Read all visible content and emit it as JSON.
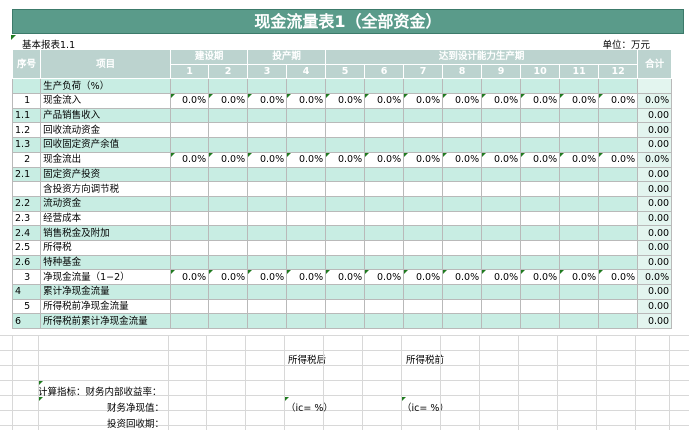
{
  "title": "现金流量表1（全部资金）",
  "subtitle_left": "基本报表1.1",
  "subtitle_right": "单位：万元",
  "headers": {
    "seq": "序号",
    "item": "项目",
    "construction": "建设期",
    "production": "投产期",
    "design_capacity": "达到设计能力生产期",
    "total": "合计",
    "periods": [
      "1",
      "2",
      "3",
      "4",
      "5",
      "6",
      "7",
      "8",
      "9",
      "10",
      "11",
      "12"
    ]
  },
  "rows": [
    {
      "seq": "",
      "label": "生产负荷（%）",
      "hl": true,
      "vals": [
        "",
        "",
        "",
        "",
        "",
        "",
        "",
        "",
        "",
        "",
        "",
        ""
      ],
      "total": ""
    },
    {
      "seq": "1",
      "label": "现金流入",
      "hl": false,
      "vals": [
        "0.0%",
        "0.0%",
        "0.0%",
        "0.0%",
        "0.0%",
        "0.0%",
        "0.0%",
        "0.0%",
        "0.0%",
        "0.0%",
        "0.0%",
        "0.0%"
      ],
      "total": "0.0%"
    },
    {
      "seq": "1.1",
      "label": "产品销售收入",
      "hl": true,
      "vals": [
        "",
        "",
        "",
        "",
        "",
        "",
        "",
        "",
        "",
        "",
        "",
        ""
      ],
      "total": "0.00"
    },
    {
      "seq": "1.2",
      "label": "回收流动资金",
      "hl": false,
      "vals": [
        "",
        "",
        "",
        "",
        "",
        "",
        "",
        "",
        "",
        "",
        "",
        ""
      ],
      "total": "0.00"
    },
    {
      "seq": "1.3",
      "label": "回收固定资产余值",
      "hl": true,
      "vals": [
        "",
        "",
        "",
        "",
        "",
        "",
        "",
        "",
        "",
        "",
        "",
        ""
      ],
      "total": "0.00"
    },
    {
      "seq": "2",
      "label": "现金流出",
      "hl": false,
      "vals": [
        "0.0%",
        "0.0%",
        "0.0%",
        "0.0%",
        "0.0%",
        "0.0%",
        "0.0%",
        "0.0%",
        "0.0%",
        "0.0%",
        "0.0%",
        "0.0%"
      ],
      "total": "0.0%"
    },
    {
      "seq": "2.1",
      "label": "固定资产投资",
      "hl": true,
      "vals": [
        "",
        "",
        "",
        "",
        "",
        "",
        "",
        "",
        "",
        "",
        "",
        ""
      ],
      "total": "0.00"
    },
    {
      "seq": "",
      "label": "含投资方向调节税",
      "hl": false,
      "vals": [
        "",
        "",
        "",
        "",
        "",
        "",
        "",
        "",
        "",
        "",
        "",
        ""
      ],
      "total": "0.00"
    },
    {
      "seq": "2.2",
      "label": "流动资金",
      "hl": true,
      "vals": [
        "",
        "",
        "",
        "",
        "",
        "",
        "",
        "",
        "",
        "",
        "",
        ""
      ],
      "total": "0.00"
    },
    {
      "seq": "2.3",
      "label": "经营成本",
      "hl": false,
      "vals": [
        "",
        "",
        "",
        "",
        "",
        "",
        "",
        "",
        "",
        "",
        "",
        ""
      ],
      "total": "0.00"
    },
    {
      "seq": "2.4",
      "label": "销售税金及附加",
      "hl": true,
      "vals": [
        "",
        "",
        "",
        "",
        "",
        "",
        "",
        "",
        "",
        "",
        "",
        ""
      ],
      "total": "0.00"
    },
    {
      "seq": "2.5",
      "label": "所得税",
      "hl": false,
      "vals": [
        "",
        "",
        "",
        "",
        "",
        "",
        "",
        "",
        "",
        "",
        "",
        ""
      ],
      "total": "0.00"
    },
    {
      "seq": "2.6",
      "label": "特种基金",
      "hl": true,
      "vals": [
        "",
        "",
        "",
        "",
        "",
        "",
        "",
        "",
        "",
        "",
        "",
        ""
      ],
      "total": "0.00"
    },
    {
      "seq": "3",
      "label": "净现金流量（1−2）",
      "hl": false,
      "vals": [
        "0.0%",
        "0.0%",
        "0.0%",
        "0.0%",
        "0.0%",
        "0.0%",
        "0.0%",
        "0.0%",
        "0.0%",
        "0.0%",
        "0.0%",
        "0.0%"
      ],
      "total": "0.0%"
    },
    {
      "seq": "4",
      "label": "累计净现金流量",
      "hl": true,
      "vals": [
        "",
        "",
        "",
        "",
        "",
        "",
        "",
        "",
        "",
        "",
        "",
        ""
      ],
      "total": "0.00"
    },
    {
      "seq": "5",
      "label": "所得税前净现金流量",
      "hl": false,
      "vals": [
        "",
        "",
        "",
        "",
        "",
        "",
        "",
        "",
        "",
        "",
        "",
        ""
      ],
      "total": "0.00"
    },
    {
      "seq": "6",
      "label": "所得税前累计净现金流量",
      "hl": true,
      "vals": [
        "",
        "",
        "",
        "",
        "",
        "",
        "",
        "",
        "",
        "",
        "",
        ""
      ],
      "total": "0.00"
    }
  ],
  "footer": {
    "after_tax": "所得税后",
    "before_tax": "所得税前",
    "calc_label": "计算指标：财务内部收益率：",
    "npv_label": "财务净现值：",
    "ic_after": "（ic=   %）",
    "ic_before": "（ic=  %）",
    "payback_label": "投资回收期："
  },
  "colors": {
    "title_bg": "#5a9b8a",
    "header_bg": "#bcd3cf",
    "row_highlight": "#c8ede3"
  }
}
